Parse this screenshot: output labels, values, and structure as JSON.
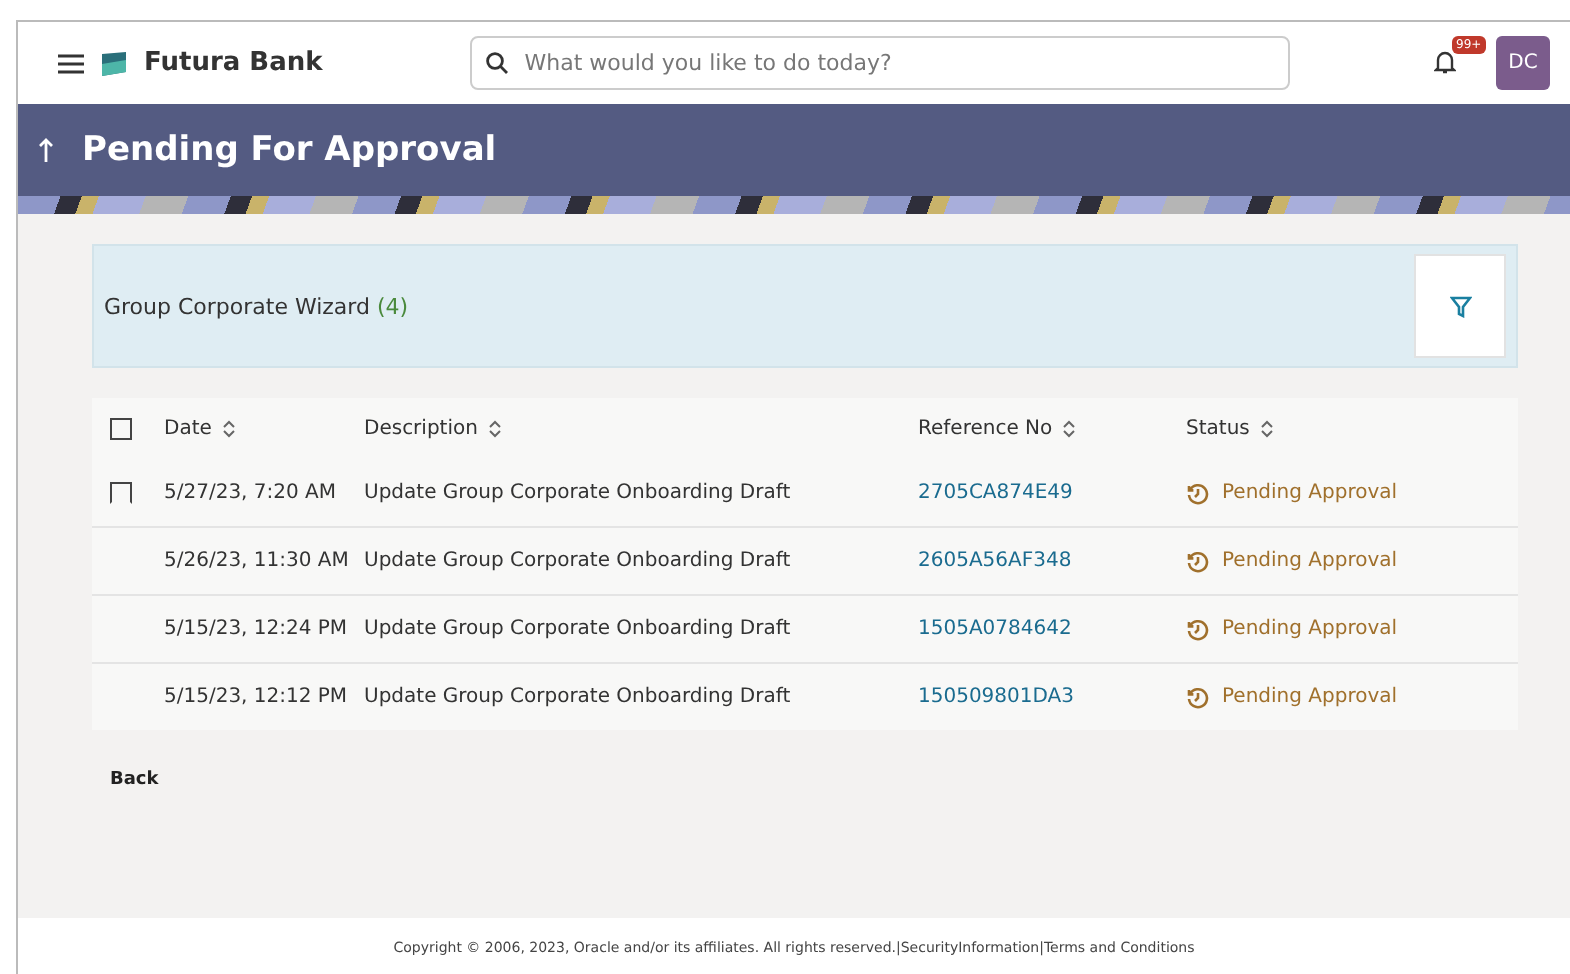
{
  "header": {
    "brand": "Futura Bank",
    "search": {
      "placeholder": "What would you like to do today?"
    },
    "notification_badge": "99+",
    "avatar": "DC"
  },
  "page": {
    "title": "Pending For Approval"
  },
  "panel": {
    "title": "Group Corporate Wizard",
    "count": "(4)"
  },
  "table": {
    "select_all": {
      "checked": false
    },
    "columns": [
      "Date",
      "Description",
      "Reference No",
      "Status"
    ],
    "rows": [
      {
        "kind": "checkbox",
        "checked": false,
        "date": "5/27/23, 7:20 AM",
        "description": "Update Group Corporate Onboarding Draft",
        "reference": "2705CA874E49",
        "status": "Pending Approval"
      },
      {
        "kind": "plain",
        "date": "5/26/23, 11:30 AM",
        "description": "Update Group Corporate Onboarding Draft",
        "reference": "2605A56AF348",
        "status": "Pending Approval"
      },
      {
        "kind": "plain",
        "date": "5/15/23, 12:24 PM",
        "description": "Update Group Corporate Onboarding Draft",
        "reference": "1505A0784642",
        "status": "Pending Approval"
      },
      {
        "kind": "plain",
        "date": "5/15/23, 12:12 PM",
        "description": "Update Group Corporate Onboarding Draft",
        "reference": "150509801DA3",
        "status": "Pending Approval"
      }
    ]
  },
  "back_link": "Back",
  "footer": {
    "copyright": "Copyright © 2006, 2023, Oracle and/or its affiliates. All rights reserved.|",
    "links": [
      "SecurityInformation",
      "Terms and Conditions"
    ],
    "separator": "|"
  }
}
